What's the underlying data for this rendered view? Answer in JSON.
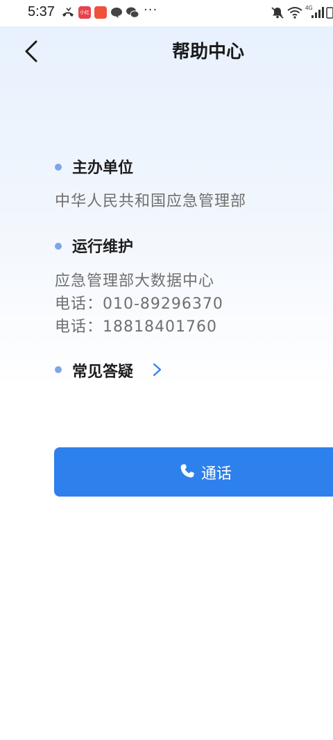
{
  "status_bar": {
    "time": "5:37",
    "badge1": "小红书",
    "badge2": "",
    "more": "···",
    "network": "4G"
  },
  "header": {
    "title": "帮助中心"
  },
  "sections": {
    "organizer": {
      "title": "主办单位",
      "text": "中华人民共和国应急管理部"
    },
    "maintenance": {
      "title": "运行维护",
      "org": "应急管理部大数据中心",
      "phone1": "电话：010-89296370",
      "phone2": "电话：18818401760"
    },
    "faq": {
      "title": "常见答疑"
    }
  },
  "call_button": {
    "label": "通话"
  },
  "colors": {
    "accent": "#2e80ec",
    "dot": "#7aa7e8"
  }
}
